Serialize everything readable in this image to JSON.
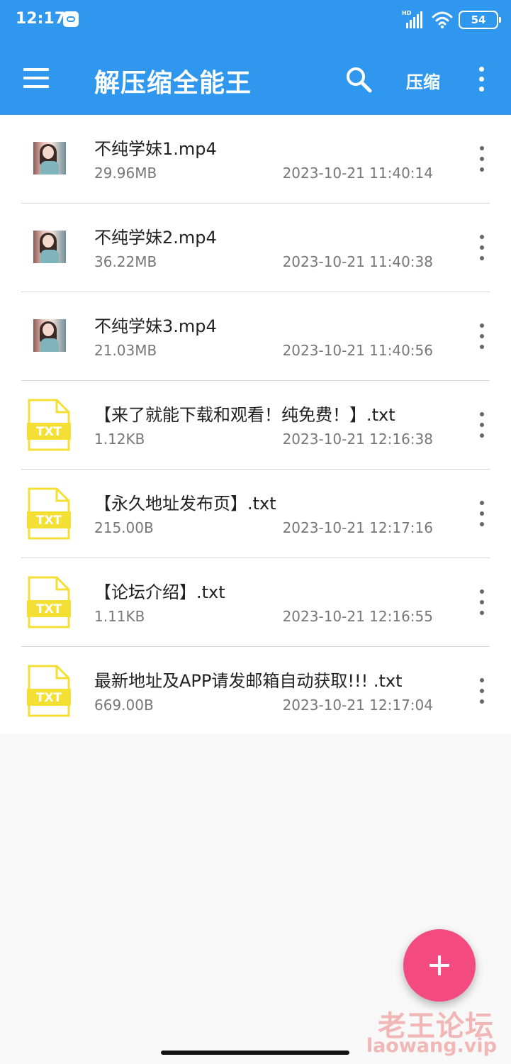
{
  "status_bar": {
    "time": "12:17",
    "network_label": "HD",
    "battery": "54"
  },
  "app_bar": {
    "title": "解压缩全能王",
    "compress_label": "压缩",
    "background_color": "#2f97ee"
  },
  "icons": {
    "menu": "menu-icon",
    "search": "search-icon",
    "overflow": "more-vertical-icon",
    "video_thumbnail": "video-thumbnail",
    "text_file": "txt-file-icon",
    "fab": "plus-icon"
  },
  "files": [
    {
      "name": "不纯学妹1.mp4",
      "size": "29.96MB",
      "date": "2023-10-21 11:40:14",
      "type": "video"
    },
    {
      "name": "不纯学妹2.mp4",
      "size": "36.22MB",
      "date": "2023-10-21 11:40:38",
      "type": "video"
    },
    {
      "name": "不纯学妹3.mp4",
      "size": "21.03MB",
      "date": "2023-10-21 11:40:56",
      "type": "video"
    },
    {
      "name": "【来了就能下载和观看！纯免费！】.txt",
      "size": "1.12KB",
      "date": "2023-10-21 12:16:38",
      "type": "txt"
    },
    {
      "name": "【永久地址发布页】.txt",
      "size": "215.00B",
      "date": "2023-10-21 12:17:16",
      "type": "txt"
    },
    {
      "name": "【论坛介绍】.txt",
      "size": "1.11KB",
      "date": "2023-10-21 12:16:55",
      "type": "txt"
    },
    {
      "name": "最新地址及APP请发邮箱自动获取!!! .txt",
      "size": "669.00B",
      "date": "2023-10-21 12:17:04",
      "type": "txt"
    }
  ],
  "txt_label": "TXT",
  "fab_color": "#f34a80",
  "watermark": {
    "title": "老王论坛",
    "url": "laowang.vip"
  }
}
